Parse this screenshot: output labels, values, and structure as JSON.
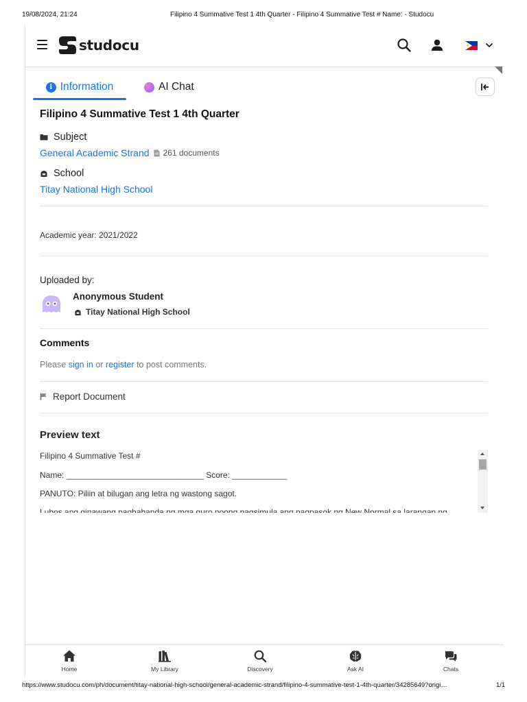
{
  "print_header": {
    "datetime": "19/08/2024, 21:24",
    "title": "Filipino 4 Summative Test 1 4th Quarter - Filipino 4 Summative Test # Name: - Studocu"
  },
  "print_footer": {
    "url": "https://www.studocu.com/ph/document/titay-national-high-school/general-academic-strand/filipino-4-summative-test-1-4th-quarter/34285649?origi…",
    "page": "1/1"
  },
  "brand": {
    "name": "studocu",
    "accent": "#1a73e8"
  },
  "tabs": [
    {
      "label": "Information",
      "active": true
    },
    {
      "label": "AI Chat",
      "active": false
    }
  ],
  "document": {
    "title": "Filipino 4 Summative Test 1 4th Quarter",
    "subject_label": "Subject",
    "subject": "General Academic Strand",
    "subject_docs": "261 documents",
    "school_label": "School",
    "school": "Titay National High School",
    "academic_year": "Academic year: 2021/2022"
  },
  "uploader": {
    "label": "Uploaded by:",
    "name": "Anonymous Student",
    "school": "Titay National High School"
  },
  "comments": {
    "heading": "Comments",
    "text_before": "Please ",
    "sign_in": "sign in",
    "text_or": " or ",
    "register": "register",
    "text_after": " to post comments."
  },
  "report_label": "Report Document",
  "preview": {
    "heading": "Preview text",
    "lines": [
      "Filipino 4 Summative Test #",
      "Name: ______________________________ Score: ____________",
      "PANUTO: Piliin at bilugan ang letra ng wastong sagot.",
      "Lubos ang ginawang paghahanda ng mga guro noong nagsimula ang pagpasok ng New Normal sa larangan ng"
    ]
  },
  "bottom_nav": [
    {
      "label": "Home",
      "icon": "home-icon"
    },
    {
      "label": "My Library",
      "icon": "library-icon"
    },
    {
      "label": "Discovery",
      "icon": "search-icon"
    },
    {
      "label": "Ask AI",
      "icon": "brain-icon"
    },
    {
      "label": "Chats",
      "icon": "chat-bubbles-icon"
    }
  ]
}
